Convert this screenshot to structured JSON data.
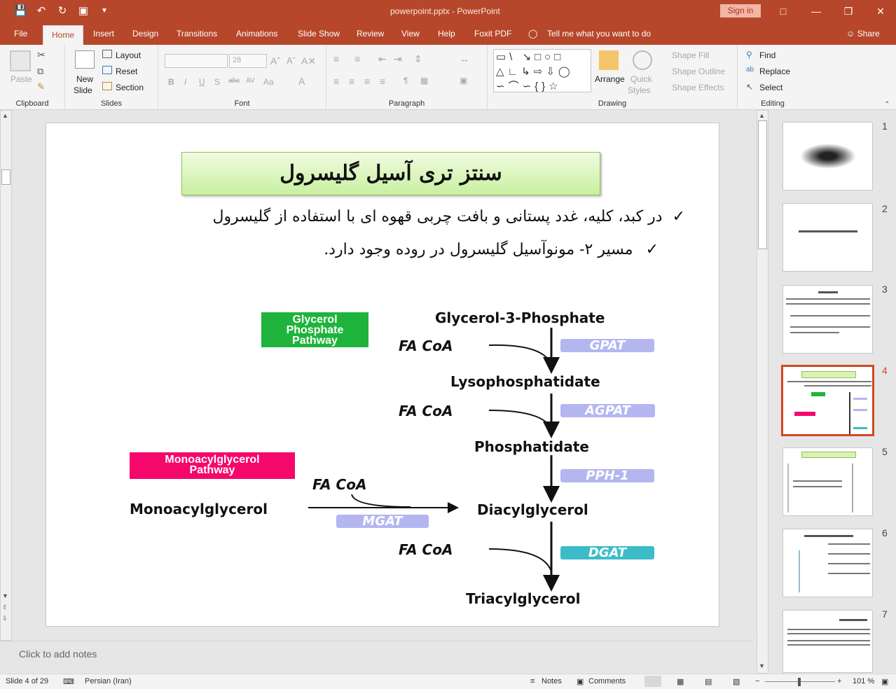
{
  "window": {
    "title": "powerpoint.pptx  -  PowerPoint",
    "signin": "Sign in"
  },
  "tabs": [
    "File",
    "Home",
    "Insert",
    "Design",
    "Transitions",
    "Animations",
    "Slide Show",
    "Review",
    "View",
    "Help",
    "Foxit PDF"
  ],
  "tell_me": "Tell me what you want to do",
  "share": "Share",
  "ribbon": {
    "clipboard": {
      "label": "Clipboard",
      "paste": "Paste"
    },
    "slides": {
      "label": "Slides",
      "new_slide": "New",
      "new_slide2": "Slide",
      "layout": "Layout",
      "reset": "Reset",
      "section": "Section"
    },
    "font": {
      "label": "Font",
      "font_size": "28"
    },
    "paragraph": {
      "label": "Paragraph"
    },
    "drawing": {
      "label": "Drawing",
      "arrange": "Arrange",
      "quick": "Quick",
      "styles": "Styles",
      "shape_fill": "Shape Fill",
      "shape_outline": "Shape Outline",
      "shape_effects": "Shape Effects"
    },
    "editing": {
      "label": "Editing",
      "find": "Find",
      "replace": "Replace",
      "select": "Select"
    }
  },
  "slide": {
    "title": "سنتز تری آسیل گلیسرول",
    "bullets": [
      "در کبد، کلیه، غدد پستانی و بافت چربی قهوه ای با استفاده از گلیسرول",
      "مسیر ۲- مونوآسیل گلیسرول در روده وجود دارد."
    ],
    "diagram": {
      "glycerol_pathway": "Glycerol Phosphate Pathway",
      "mono_pathway": "Monoacylglycerol Pathway",
      "g3p": "Glycerol-3-Phosphate",
      "lyso": "Lysophosphatidate",
      "phos": "Phosphatidate",
      "dag": "Diacylglycerol",
      "tag": "Triacylglycerol",
      "mag": "Monoacylglycerol",
      "facoa": "FA CoA",
      "gpat": "GPAT",
      "agpat": "AGPAT",
      "pph": "PPH-1",
      "mgat": "MGAT",
      "dgat": "DGAT",
      "colors": {
        "enzyme": "#b4b6f0",
        "dgat": "#3cbcc8",
        "green": "#1eb43c",
        "pink": "#f5076c"
      }
    }
  },
  "thumbnails": [
    "1",
    "2",
    "3",
    "4",
    "5",
    "6",
    "7"
  ],
  "notes_placeholder": "Click to add notes",
  "status": {
    "slide": "Slide 4 of 29",
    "language": "Persian (Iran)",
    "notes": "Notes",
    "comments": "Comments",
    "zoom": "101 %"
  }
}
